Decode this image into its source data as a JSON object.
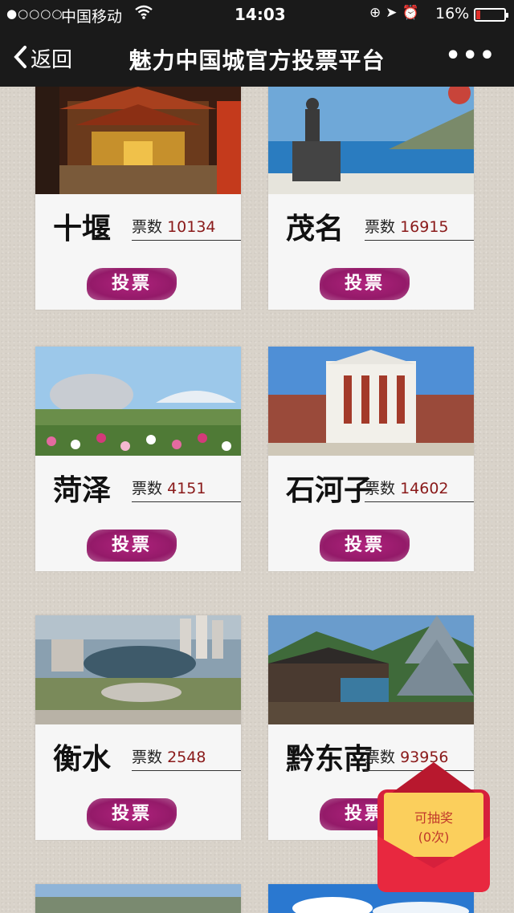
{
  "status_bar": {
    "signal": "●○○○○",
    "carrier": "中国移动",
    "time": "14:03",
    "battery": "16%",
    "battery_level": 0.16
  },
  "nav": {
    "back_label": "返回",
    "title": "魅力中国城官方投票平台",
    "more_label": "•••"
  },
  "cards": [
    {
      "name": "十堰",
      "votes_label": "票数",
      "votes": "10134",
      "button": "投票"
    },
    {
      "name": "茂名",
      "votes_label": "票数",
      "votes": "16915",
      "button": "投票"
    },
    {
      "name": "菏泽",
      "votes_label": "票数",
      "votes": "4151",
      "button": "投票"
    },
    {
      "name": "石河子",
      "votes_label": "票数",
      "votes": "14602",
      "button": "投票"
    },
    {
      "name": "衡水",
      "votes_label": "票数",
      "votes": "2548",
      "button": "投票"
    },
    {
      "name": "黔东南",
      "votes_label": "票数",
      "votes": "93956",
      "button": "投票"
    }
  ],
  "lottery": {
    "line1": "可抽奖",
    "line2": "(0次)"
  }
}
